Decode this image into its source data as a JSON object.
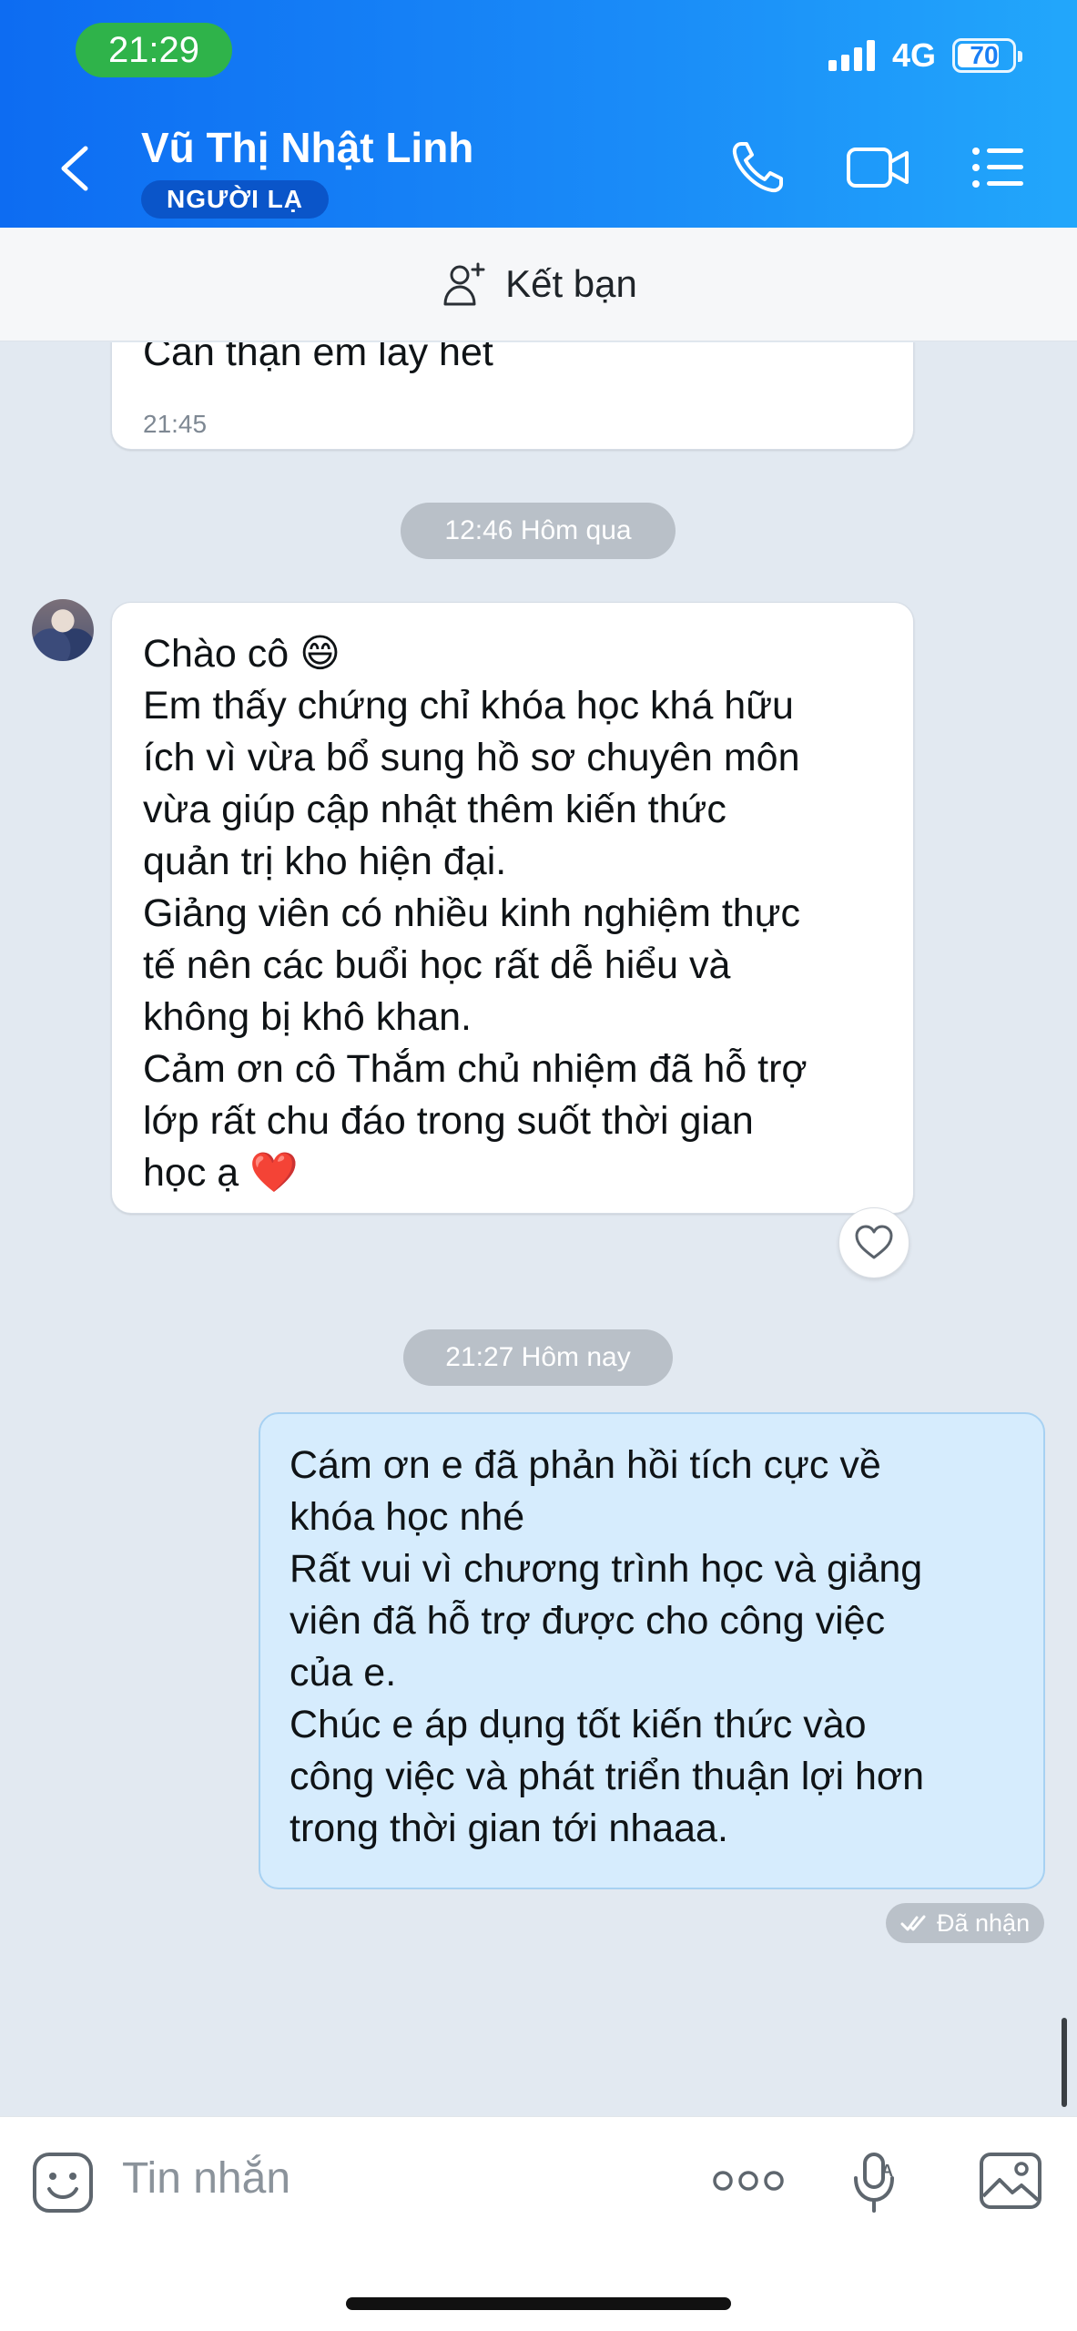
{
  "status": {
    "time": "21:29",
    "network": "4G",
    "battery": "70"
  },
  "header": {
    "contact_name": "Vũ Thị Nhật Linh",
    "badge": "NGƯỜI LẠ"
  },
  "friend_bar": {
    "label": "Kết bạn"
  },
  "messages": {
    "prev": {
      "text": "Cẩn thận em lấy hết",
      "time": "21:45"
    },
    "sep1": "12:46 Hôm qua",
    "incoming": {
      "lines": [
        "Chào cô 😄",
        "Em thấy chứng chỉ khóa học khá hữu",
        "ích vì vừa bổ sung hồ sơ chuyên môn",
        "vừa giúp cập nhật thêm kiến thức",
        "quản trị kho hiện đại.",
        "Giảng viên có nhiều kinh nghiệm thực",
        "tế nên các buổi học rất dễ hiểu và",
        "không bị khô khan.",
        "Cảm ơn cô Thắm chủ nhiệm đã hỗ trợ",
        "lớp rất chu đáo trong suốt thời gian",
        "học ạ ❤️"
      ]
    },
    "sep2": "21:27 Hôm nay",
    "outgoing": {
      "lines": [
        "Cám ơn e đã phản hồi tích cực về",
        "khóa học nhé",
        "Rất vui vì chương trình học và giảng",
        "viên đã hỗ trợ được cho công việc",
        "của e.",
        "Chúc e áp dụng tốt kiến thức vào",
        "công việc và phát triển thuận lợi hơn",
        "trong thời gian tới nhaaa."
      ],
      "status": "Đã nhận"
    }
  },
  "input": {
    "placeholder": "Tin nhắn"
  },
  "colors": {
    "header_start": "#0d6cf2",
    "header_end": "#22a7fb",
    "outgoing_bubble": "#d6ecfd",
    "clock_pill": "#2fb34a"
  }
}
